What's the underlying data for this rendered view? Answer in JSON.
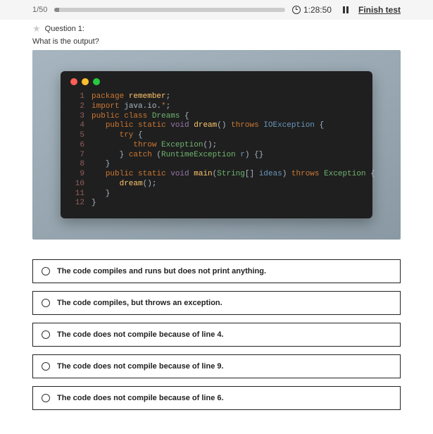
{
  "header": {
    "counter": "1/50",
    "time_remaining": "1:28:50",
    "finish_label": "Finish test"
  },
  "question": {
    "number_label": "Question 1:",
    "prompt": "What is the output?"
  },
  "code": {
    "lines": [
      {
        "n": "1",
        "tokens": [
          {
            "c": "kw",
            "t": "package "
          },
          {
            "c": "id",
            "t": "remember"
          },
          {
            "c": "pln",
            "t": ";"
          }
        ]
      },
      {
        "n": "2",
        "tokens": [
          {
            "c": "kw",
            "t": "import "
          },
          {
            "c": "pln",
            "t": "java.io."
          },
          {
            "c": "kw",
            "t": "*"
          },
          {
            "c": "pln",
            "t": ";"
          }
        ]
      },
      {
        "n": "3",
        "tokens": [
          {
            "c": "kw",
            "t": "public class "
          },
          {
            "c": "cls",
            "t": "Dreams"
          },
          {
            "c": "pln",
            "t": " {"
          }
        ]
      },
      {
        "n": "4",
        "tokens": [
          {
            "c": "pln",
            "t": "   "
          },
          {
            "c": "kw",
            "t": "public static "
          },
          {
            "c": "str",
            "t": "void"
          },
          {
            "c": "fn",
            "t": " dream"
          },
          {
            "c": "pln",
            "t": "() "
          },
          {
            "c": "kw",
            "t": "throws "
          },
          {
            "c": "exc",
            "t": "IOException"
          },
          {
            "c": "pln",
            "t": " {"
          }
        ]
      },
      {
        "n": "5",
        "tokens": [
          {
            "c": "pln",
            "t": "      "
          },
          {
            "c": "kw",
            "t": "try"
          },
          {
            "c": "pln",
            "t": " {"
          }
        ]
      },
      {
        "n": "6",
        "tokens": [
          {
            "c": "pln",
            "t": "         "
          },
          {
            "c": "kw",
            "t": "throw "
          },
          {
            "c": "thr",
            "t": "Exception"
          },
          {
            "c": "pln",
            "t": "();"
          }
        ]
      },
      {
        "n": "7",
        "tokens": [
          {
            "c": "pln",
            "t": "      } "
          },
          {
            "c": "kw",
            "t": "catch"
          },
          {
            "c": "pln",
            "t": " ("
          },
          {
            "c": "thr",
            "t": "RuntimeException"
          },
          {
            "c": "par",
            "t": " r"
          },
          {
            "c": "pln",
            "t": ") {}"
          }
        ]
      },
      {
        "n": "8",
        "tokens": [
          {
            "c": "pln",
            "t": "   }"
          }
        ]
      },
      {
        "n": "9",
        "tokens": [
          {
            "c": "pln",
            "t": "   "
          },
          {
            "c": "kw",
            "t": "public static "
          },
          {
            "c": "str",
            "t": "void"
          },
          {
            "c": "fn",
            "t": " main"
          },
          {
            "c": "pln",
            "t": "("
          },
          {
            "c": "thr",
            "t": "String"
          },
          {
            "c": "pln",
            "t": "[] "
          },
          {
            "c": "par",
            "t": "ideas"
          },
          {
            "c": "pln",
            "t": ") "
          },
          {
            "c": "kw",
            "t": "throws "
          },
          {
            "c": "thr",
            "t": "Exception"
          },
          {
            "c": "pln",
            "t": " {"
          }
        ]
      },
      {
        "n": "10",
        "tokens": [
          {
            "c": "pln",
            "t": "      "
          },
          {
            "c": "fn",
            "t": "dream"
          },
          {
            "c": "pln",
            "t": "();"
          }
        ]
      },
      {
        "n": "11",
        "tokens": [
          {
            "c": "pln",
            "t": "   }"
          }
        ]
      },
      {
        "n": "12",
        "tokens": [
          {
            "c": "pln",
            "t": "}"
          }
        ]
      }
    ]
  },
  "options": [
    {
      "text": "The code compiles and runs but does not print anything."
    },
    {
      "text": "The code compiles, but throws an exception."
    },
    {
      "text": "The code does not compile because of line 4."
    },
    {
      "text": "The code does not compile because of line 9."
    },
    {
      "text": "The code does not compile because of line 6."
    }
  ]
}
